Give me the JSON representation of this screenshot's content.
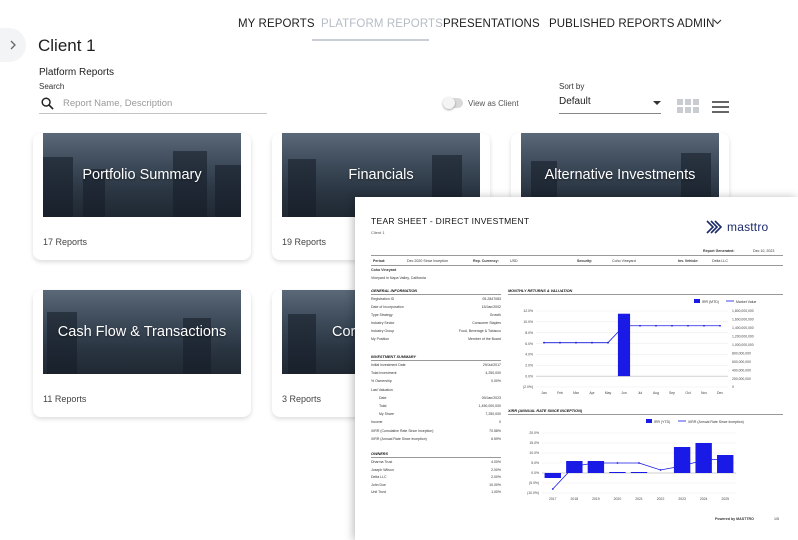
{
  "nav": {
    "items": [
      "MY REPORTS",
      "PLATFORM REPORTS",
      "PRESENTATIONS",
      "PUBLISHED REPORTS",
      "ADMIN"
    ],
    "active": "PLATFORM REPORTS"
  },
  "page": {
    "client": "Client 1",
    "section": "Platform Reports"
  },
  "search": {
    "label": "Search",
    "placeholder": "Report Name, Description"
  },
  "view_toggle": {
    "label": "View as Client",
    "on": false
  },
  "sort": {
    "label": "Sort by",
    "value": "Default"
  },
  "cards": [
    {
      "title": "Portfolio Summary",
      "count": "17 Reports"
    },
    {
      "title": "Financials",
      "count": "19 Reports"
    },
    {
      "title": "Alternative Investments",
      "count": ""
    },
    {
      "title": "Cash Flow & Transactions",
      "count": "11 Reports"
    },
    {
      "title": "Corp",
      "count": "3 Reports"
    }
  ],
  "colors": {
    "accent": "#1a1ae6",
    "nav_active": "#b6bcc6",
    "logo": "#1b2a6b"
  },
  "tearsheet": {
    "title": "TEAR SHEET - DIRECT INVESTMENT",
    "client": "Client 1",
    "logo": "masttro",
    "report_generated_label": "Report Generated:",
    "report_generated": "Dec 10, 2023",
    "period_label": "Period:",
    "period": "Dec 2020 Since Inception",
    "currency_label": "Rep. Currency:",
    "currency": "USD",
    "security_label": "Security:",
    "security": "Coho Vineyard",
    "vehicle_label": "Inv. Vehicle:",
    "vehicle": "Delta LLC",
    "entity": "Coho Vineyard",
    "location": "Vineyard in Napa Valley, California",
    "general_info": {
      "heading": "GENERAL INFORMATION",
      "rows": [
        [
          "Registration ID",
          "05-2847083"
        ],
        [
          "Date of Incorporation",
          "15/Jan/2002"
        ],
        [
          "Type Strategy",
          "Growth"
        ],
        [
          "Industry Sector",
          "Consumer Staples"
        ],
        [
          "Industry Group",
          "Food, Beverage & Tobacco"
        ],
        [
          "My Position",
          "Member of the Board"
        ]
      ]
    },
    "investment_summary": {
      "heading": "INVESTMENT SUMMARY",
      "rows": [
        [
          "Initial Investment Date",
          "29/Jul/2017"
        ],
        [
          "Total Investment",
          "4,250,000"
        ],
        [
          "% Ownership",
          "0.00%"
        ],
        [
          "Last Valuation",
          ""
        ],
        [
          "Date",
          "09/Jan/2023"
        ],
        [
          "Total",
          "1,450,000,000"
        ],
        [
          "My Share",
          "7,250,000"
        ],
        [
          "Income",
          "0"
        ],
        [
          "XIRR (Cumulative Rate Since Inception)",
          "70.58%"
        ],
        [
          "XIRR (Annual Rate Since Inception)",
          "6.59%"
        ]
      ]
    },
    "owners": {
      "heading": "OWNERS",
      "rows": [
        [
          "Dharma Trust",
          "4.00%"
        ],
        [
          "Joseph Wilson",
          "2.00%"
        ],
        [
          "Delta LLC",
          "2.00%"
        ],
        [
          "John Doe",
          "10.00%"
        ],
        [
          "Unit Trust",
          "1.00%"
        ]
      ]
    },
    "footer": "Powered by MASTTRO",
    "page": "1/5"
  },
  "chart_data": [
    {
      "type": "bar",
      "title": "MONTHLY RETURNS & VALUATION",
      "categories": [
        "Jan",
        "Feb",
        "Mar",
        "Apr",
        "May",
        "Jun",
        "Jul",
        "Aug",
        "Sep",
        "Oct",
        "Nov",
        "Dec"
      ],
      "series": [
        {
          "name": "IRR (MTD)",
          "type": "bar",
          "values": [
            0,
            0,
            0,
            0,
            0,
            11.5,
            0,
            0,
            0,
            0,
            0,
            0
          ]
        },
        {
          "name": "Market Value",
          "type": "line",
          "values": [
            1050000000,
            1050000000,
            1050000000,
            1050000000,
            1050000000,
            1450000000,
            1450000000,
            1450000000,
            1450000000,
            1450000000,
            1450000000,
            1450000000
          ]
        }
      ],
      "ylim": [
        -2,
        12
      ],
      "yticks": [
        "12.0%",
        "10.0%",
        "8.0%",
        "6.0%",
        "4.0%",
        "2.0%",
        "0.0%",
        "(2.0%)"
      ],
      "y2ticks": [
        "1,800,000,000",
        "1,600,000,000",
        "1,400,000,000",
        "1,200,000,000",
        "1,000,000,000",
        "800,000,000",
        "600,000,000",
        "400,000,000",
        "200,000,000",
        "0"
      ],
      "legend": "top-right",
      "color": "#1a1ae6"
    },
    {
      "type": "bar",
      "title": "XIRR (ANNUAL RATE SINCE INCEPTION)",
      "categories": [
        "2017",
        "2018",
        "2019",
        "2020",
        "2021",
        "2022",
        "2023",
        "2024",
        "2025"
      ],
      "series": [
        {
          "name": "IRR (YTD)",
          "type": "bar",
          "values": [
            -2.5,
            6.0,
            6.0,
            0.5,
            0.5,
            0,
            13.0,
            15.0,
            9.0
          ]
        },
        {
          "name": "XIRR (Annual Rate Since Inception)",
          "type": "line",
          "values": [
            -8.0,
            3.5,
            5.0,
            5.0,
            5.0,
            1.5,
            3.5,
            6.5,
            7.0
          ]
        }
      ],
      "ylim": [
        -10,
        20
      ],
      "yticks": [
        "20.0%",
        "15.0%",
        "10.0%",
        "5.0%",
        "0.0%",
        "(5.0%)",
        "(10.0%)"
      ],
      "legend": "top-right",
      "color": "#1a1ae6"
    }
  ]
}
